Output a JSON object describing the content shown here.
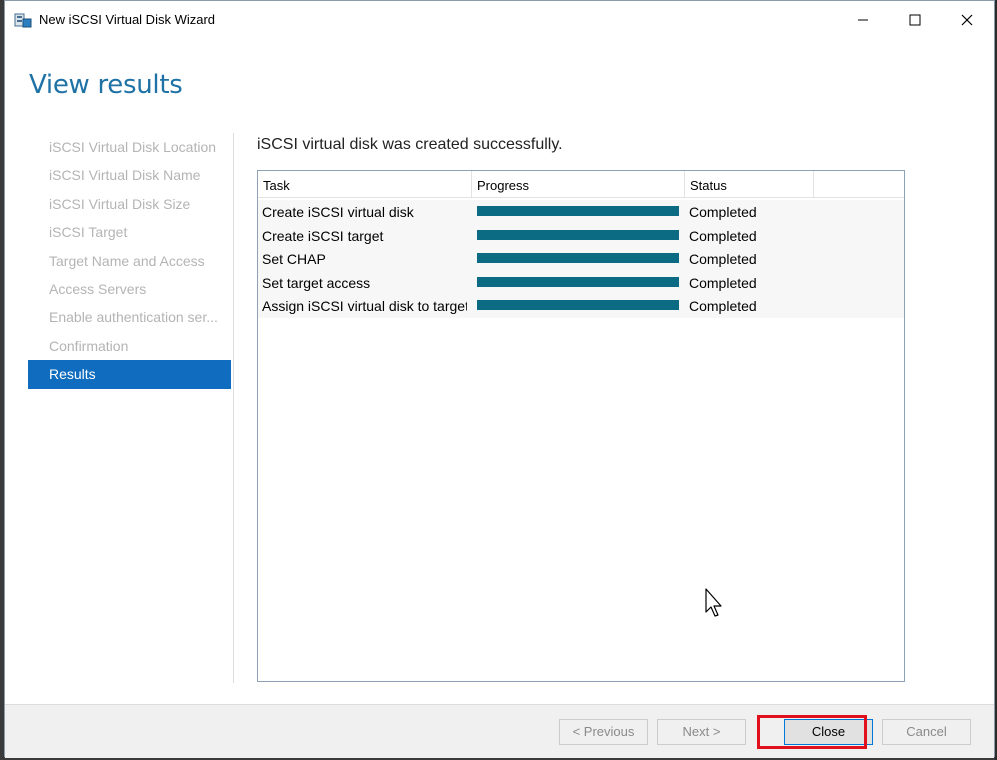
{
  "window": {
    "title": "New iSCSI Virtual Disk Wizard",
    "controls": {
      "minimize": "—",
      "maximize": "☐",
      "close": "✕"
    }
  },
  "page": {
    "heading": "View results",
    "result_message": "iSCSI virtual disk was created successfully."
  },
  "nav": {
    "items": [
      {
        "label": "iSCSI Virtual Disk Location"
      },
      {
        "label": "iSCSI Virtual Disk Name"
      },
      {
        "label": "iSCSI Virtual Disk Size"
      },
      {
        "label": "iSCSI Target"
      },
      {
        "label": "Target Name and Access"
      },
      {
        "label": "Access Servers"
      },
      {
        "label": "Enable authentication ser..."
      },
      {
        "label": "Confirmation"
      },
      {
        "label": "Results"
      }
    ],
    "active_index": 8
  },
  "table": {
    "columns": [
      "Task",
      "Progress",
      "Status"
    ],
    "rows": [
      {
        "task": "Create iSCSI virtual disk",
        "progress": 1.0,
        "status": "Completed"
      },
      {
        "task": "Create iSCSI target",
        "progress": 1.0,
        "status": "Completed"
      },
      {
        "task": "Set CHAP",
        "progress": 1.0,
        "status": "Completed"
      },
      {
        "task": "Set target access",
        "progress": 1.0,
        "status": "Completed"
      },
      {
        "task": "Assign iSCSI virtual disk to target",
        "progress": 1.0,
        "status": "Completed"
      }
    ]
  },
  "footer": {
    "previous_label": "< Previous",
    "next_label": "Next >",
    "close_label": "Close",
    "cancel_label": "Cancel"
  },
  "colors": {
    "accent": "#0f6cbf",
    "heading": "#1e72a6",
    "progress_fill": "#0b6b83",
    "highlight": "#e0101d"
  },
  "icons": {
    "app": "server-disk-icon",
    "cursor": "mouse-pointer-icon"
  }
}
